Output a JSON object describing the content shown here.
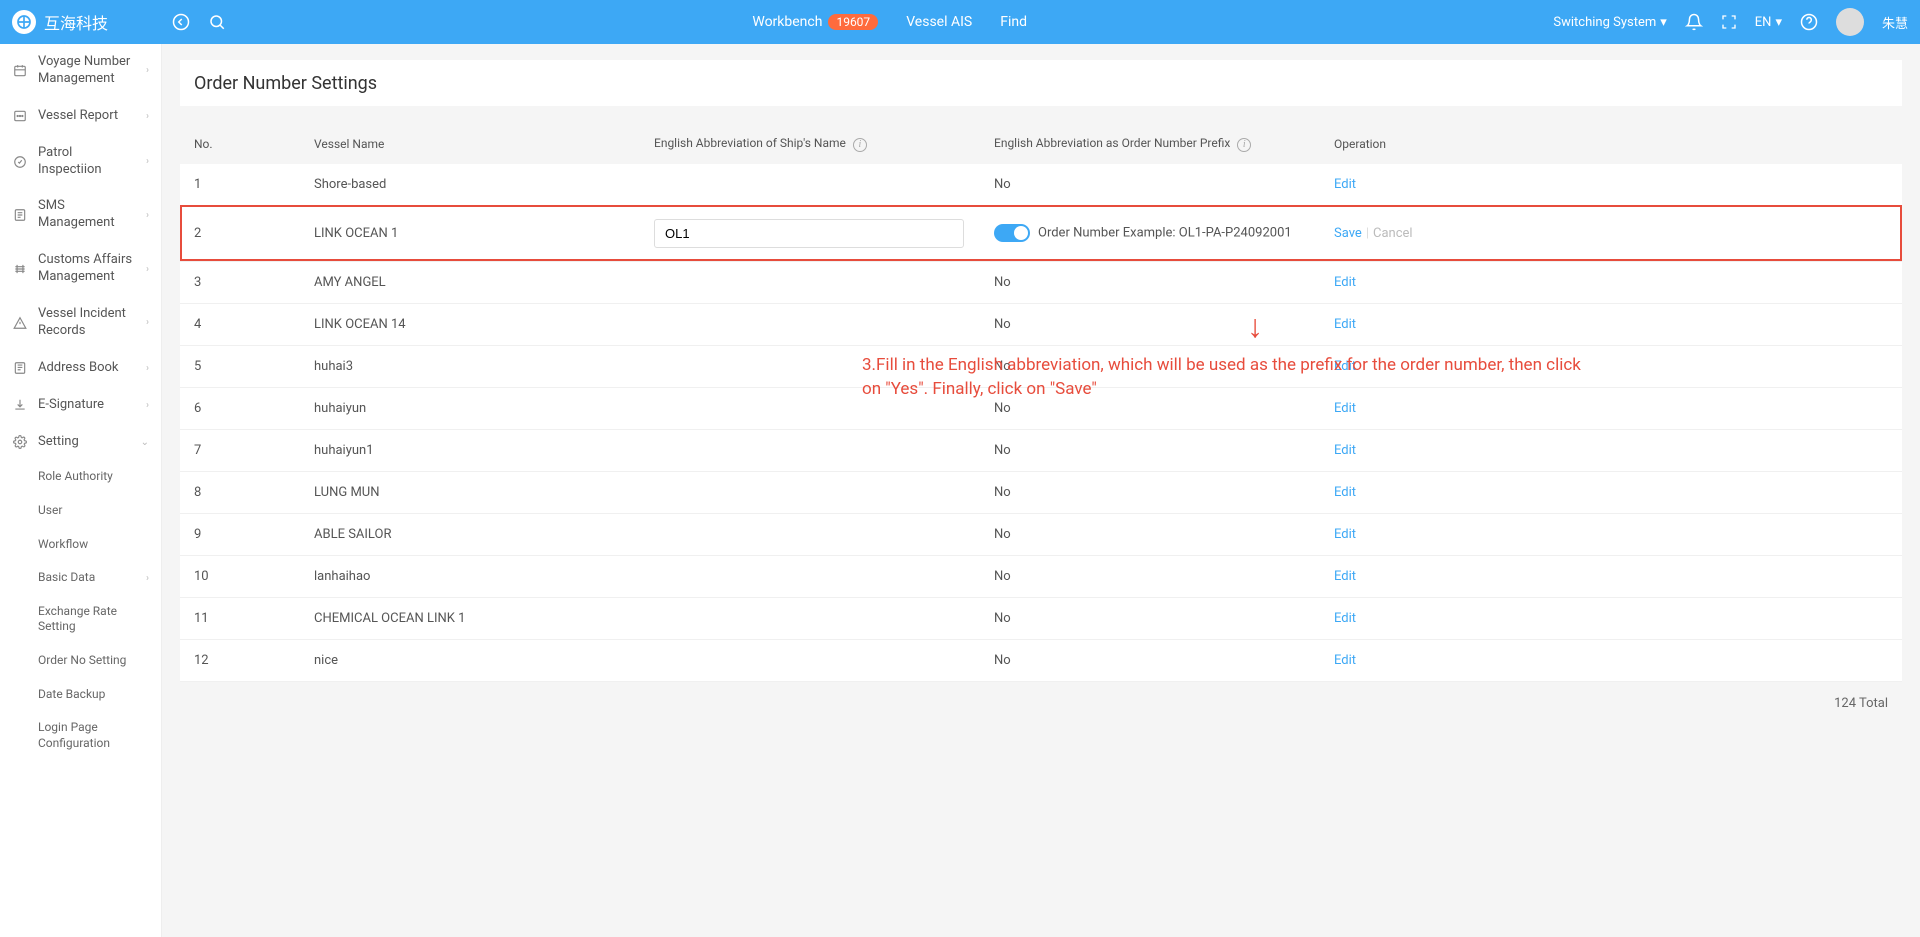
{
  "header": {
    "logo_text": "互海科技",
    "center": {
      "workbench": "Workbench",
      "workbench_badge": "19607",
      "vessel_ais": "Vessel AIS",
      "find": "Find"
    },
    "right": {
      "switching_system": "Switching System",
      "lang": "EN",
      "username": "朱慧"
    }
  },
  "sidebar": {
    "items": [
      {
        "label": "Voyage Number Management",
        "icon": "voyage"
      },
      {
        "label": "Vessel Report",
        "icon": "report"
      },
      {
        "label": "Patrol Inspectiion",
        "icon": "patrol"
      },
      {
        "label": "SMS Management",
        "icon": "sms"
      },
      {
        "label": "Customs Affairs Management",
        "icon": "customs"
      },
      {
        "label": "Vessel Incident Records",
        "icon": "incident"
      },
      {
        "label": "Address Book",
        "icon": "address"
      },
      {
        "label": "E-Signature",
        "icon": "signature"
      },
      {
        "label": "Setting",
        "icon": "setting"
      }
    ],
    "sub_items": [
      {
        "label": "Role Authority"
      },
      {
        "label": "User"
      },
      {
        "label": "Workflow"
      },
      {
        "label": "Basic Data"
      },
      {
        "label": "Exchange Rate Setting"
      },
      {
        "label": "Order No Setting"
      },
      {
        "label": "Date Backup"
      },
      {
        "label": "Login Page Configuration"
      }
    ]
  },
  "page": {
    "title": "Order Number Settings"
  },
  "table": {
    "headers": {
      "no": "No.",
      "vessel_name": "Vessel Name",
      "abbr": "English Abbreviation of Ship's Name",
      "prefix": "English Abbreviation as Order Number Prefix",
      "operation": "Operation"
    },
    "edit_link": "Edit",
    "save_link": "Save",
    "cancel_link": "Cancel",
    "editing_row": {
      "no": "2",
      "name": "LINK OCEAN 1",
      "abbr_value": "OL1",
      "example": "Order Number Example: OL1-PA-P24092001"
    },
    "rows": [
      {
        "no": "1",
        "name": "Shore-based",
        "prefix": "No"
      },
      {
        "no": "3",
        "name": "AMY ANGEL",
        "prefix": "No"
      },
      {
        "no": "4",
        "name": "LINK OCEAN 14",
        "prefix": "No"
      },
      {
        "no": "5",
        "name": "huhai3",
        "prefix": "No"
      },
      {
        "no": "6",
        "name": "huhaiyun",
        "prefix": "No"
      },
      {
        "no": "7",
        "name": "huhaiyun1",
        "prefix": "No"
      },
      {
        "no": "8",
        "name": "LUNG MUN",
        "prefix": "No"
      },
      {
        "no": "9",
        "name": "ABLE SAILOR",
        "prefix": "No"
      },
      {
        "no": "10",
        "name": "lanhaihao",
        "prefix": "No"
      },
      {
        "no": "11",
        "name": "CHEMICAL OCEAN LINK 1",
        "prefix": "No"
      },
      {
        "no": "12",
        "name": "nice",
        "prefix": "No"
      }
    ],
    "total_text": "124 Total"
  },
  "annotation": {
    "text": "3.Fill in the English abbreviation, which will be used as the prefix for the order number, then click on \"Yes\". Finally, click on \"Save\""
  }
}
